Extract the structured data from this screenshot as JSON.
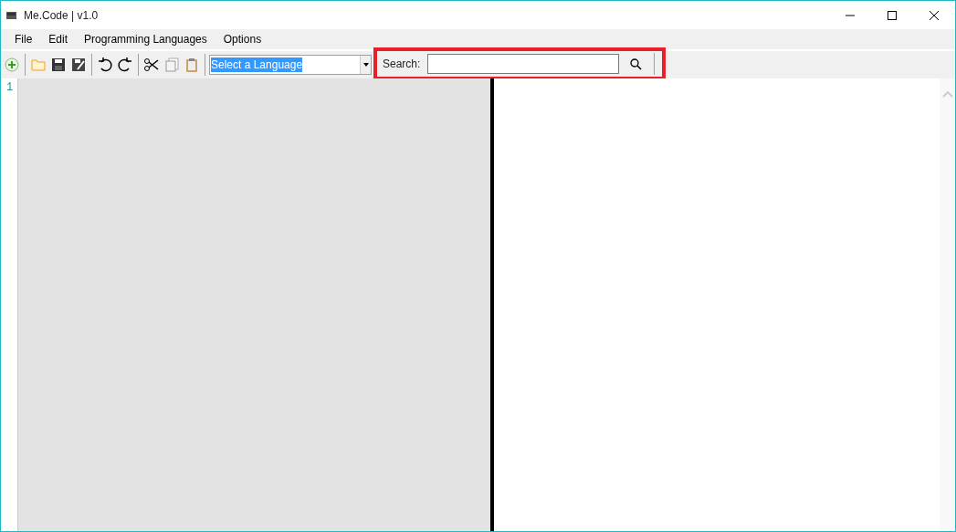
{
  "window": {
    "title": "Me.Code | v1.0"
  },
  "menu": [
    "File",
    "Edit",
    "Programming Languages",
    "Options"
  ],
  "toolbar": {
    "language_select": {
      "value": "Select a Language"
    },
    "search": {
      "label": "Search:",
      "highlighted": true
    }
  },
  "editor": {
    "line_numbers": [
      "1"
    ]
  }
}
